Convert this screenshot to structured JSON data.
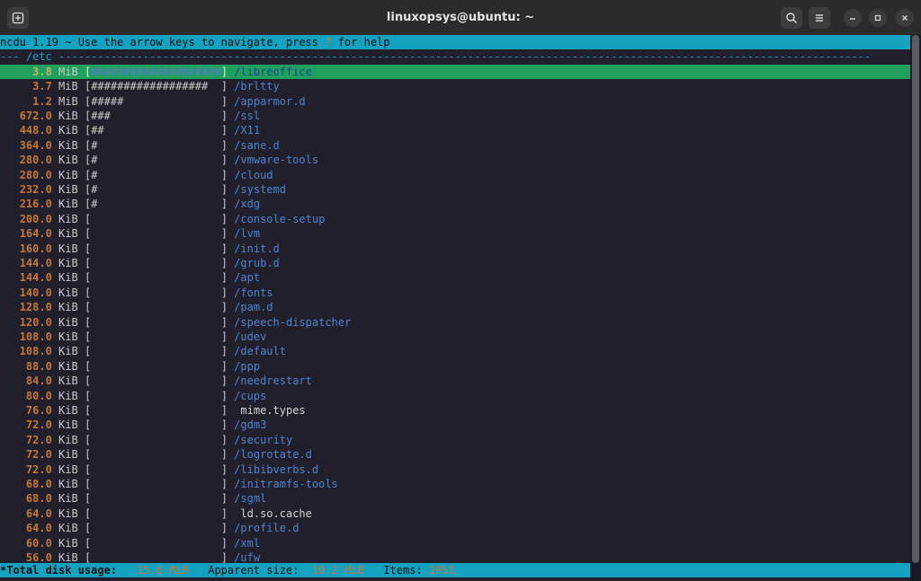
{
  "window": {
    "title": "linuxopsys@ubuntu: ~",
    "new_tab_icon": "new-tab-icon",
    "search_icon": "search-icon",
    "menu_icon": "hamburger-menu-icon",
    "minimize_icon": "minimize-icon",
    "maximize_icon": "maximize-icon",
    "close_icon": "close-icon"
  },
  "header": {
    "prefix": "ncdu 1.19 ~ Use the arrow keys to navigate, press ",
    "key": "?",
    "suffix": " for help"
  },
  "path": "--- /etc -----------------------------------------------------------------------------------------------------------------------------",
  "rows": [
    {
      "size": "3.8",
      "unit": "MiB",
      "bar": "####################",
      "name": "/libreoffice",
      "type": "dir",
      "selected": true
    },
    {
      "size": "3.7",
      "unit": "MiB",
      "bar": "################## ",
      "name": "/brltty",
      "type": "dir"
    },
    {
      "size": "1.2",
      "unit": "MiB",
      "bar": "#####",
      "name": "/apparmor.d",
      "type": "dir"
    },
    {
      "size": "672.0",
      "unit": "KiB",
      "bar": "###",
      "name": "/ssl",
      "type": "dir"
    },
    {
      "size": "448.0",
      "unit": "KiB",
      "bar": "##",
      "name": "/X11",
      "type": "dir"
    },
    {
      "size": "364.0",
      "unit": "KiB",
      "bar": "#",
      "name": "/sane.d",
      "type": "dir"
    },
    {
      "size": "280.0",
      "unit": "KiB",
      "bar": "#",
      "name": "/vmware-tools",
      "type": "dir"
    },
    {
      "size": "280.0",
      "unit": "KiB",
      "bar": "#",
      "name": "/cloud",
      "type": "dir"
    },
    {
      "size": "232.0",
      "unit": "KiB",
      "bar": "#",
      "name": "/systemd",
      "type": "dir"
    },
    {
      "size": "216.0",
      "unit": "KiB",
      "bar": "#",
      "name": "/xdg",
      "type": "dir"
    },
    {
      "size": "200.0",
      "unit": "KiB",
      "bar": "",
      "name": "/console-setup",
      "type": "dir"
    },
    {
      "size": "164.0",
      "unit": "KiB",
      "bar": "",
      "name": "/lvm",
      "type": "dir"
    },
    {
      "size": "160.0",
      "unit": "KiB",
      "bar": "",
      "name": "/init.d",
      "type": "dir"
    },
    {
      "size": "144.0",
      "unit": "KiB",
      "bar": "",
      "name": "/grub.d",
      "type": "dir"
    },
    {
      "size": "144.0",
      "unit": "KiB",
      "bar": "",
      "name": "/apt",
      "type": "dir"
    },
    {
      "size": "140.0",
      "unit": "KiB",
      "bar": "",
      "name": "/fonts",
      "type": "dir"
    },
    {
      "size": "128.0",
      "unit": "KiB",
      "bar": "",
      "name": "/pam.d",
      "type": "dir"
    },
    {
      "size": "120.0",
      "unit": "KiB",
      "bar": "",
      "name": "/speech-dispatcher",
      "type": "dir"
    },
    {
      "size": "108.0",
      "unit": "KiB",
      "bar": "",
      "name": "/udev",
      "type": "dir"
    },
    {
      "size": "108.0",
      "unit": "KiB",
      "bar": "",
      "name": "/default",
      "type": "dir"
    },
    {
      "size": "88.0",
      "unit": "KiB",
      "bar": "",
      "name": "/ppp",
      "type": "dir"
    },
    {
      "size": "84.0",
      "unit": "KiB",
      "bar": "",
      "name": "/needrestart",
      "type": "dir"
    },
    {
      "size": "80.0",
      "unit": "KiB",
      "bar": "",
      "name": "/cups",
      "type": "dir"
    },
    {
      "size": "76.0",
      "unit": "KiB",
      "bar": "",
      "name": "mime.types",
      "type": "file"
    },
    {
      "size": "72.0",
      "unit": "KiB",
      "bar": "",
      "name": "/gdm3",
      "type": "dir"
    },
    {
      "size": "72.0",
      "unit": "KiB",
      "bar": "",
      "name": "/security",
      "type": "dir"
    },
    {
      "size": "72.0",
      "unit": "KiB",
      "bar": "",
      "name": "/logrotate.d",
      "type": "dir"
    },
    {
      "size": "72.0",
      "unit": "KiB",
      "bar": "",
      "name": "/libibverbs.d",
      "type": "dir"
    },
    {
      "size": "68.0",
      "unit": "KiB",
      "bar": "",
      "name": "/initramfs-tools",
      "type": "dir"
    },
    {
      "size": "68.0",
      "unit": "KiB",
      "bar": "",
      "name": "/sgml",
      "type": "dir"
    },
    {
      "size": "64.0",
      "unit": "KiB",
      "bar": "",
      "name": "ld.so.cache",
      "type": "file"
    },
    {
      "size": "64.0",
      "unit": "KiB",
      "bar": "",
      "name": "/profile.d",
      "type": "dir"
    },
    {
      "size": "60.0",
      "unit": "KiB",
      "bar": "",
      "name": "/xml",
      "type": "dir"
    },
    {
      "size": "56.0",
      "unit": "KiB",
      "bar": "",
      "name": "/ufw",
      "type": "dir"
    }
  ],
  "footer": {
    "total_label": "*Total disk usage:",
    "total_value": "15.6 MiB",
    "apparent_label": "Apparent size:",
    "apparent_value": "10.2 MiB",
    "items_label": "Items:",
    "items_value": "2951"
  },
  "colors": {
    "terminal_bg": "#211f2b",
    "header_bg": "#13a2c0",
    "selection_bg": "#1fa05c",
    "size_color": "#c4773a",
    "dir_color": "#4f84cf"
  }
}
